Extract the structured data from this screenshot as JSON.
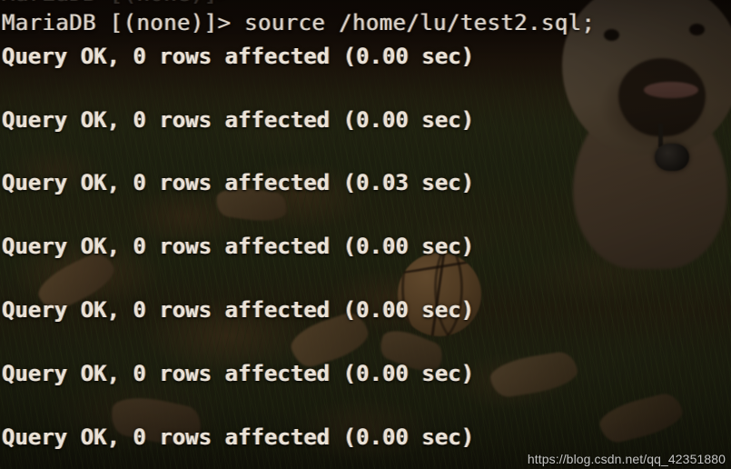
{
  "terminal": {
    "app": "MariaDB client",
    "prompt_line": "MariaDB [(none)]> source /home/lu/test2.sql;",
    "truncated_top_line": "MariaDB [(none)]>",
    "lines": [
      {
        "text": "Query OK, 0 rows affected (0.00 sec)",
        "duration": "0.00 sec"
      },
      {
        "text": "Query OK, 0 rows affected (0.00 sec)",
        "duration": "0.00 sec"
      },
      {
        "text": "Query OK, 0 rows affected (0.03 sec)",
        "duration": "0.03 sec"
      },
      {
        "text": "Query OK, 0 rows affected (0.00 sec)",
        "duration": "0.00 sec"
      },
      {
        "text": "Query OK, 0 rows affected (0.00 sec)",
        "duration": "0.00 sec"
      },
      {
        "text": "Query OK, 0 rows affected (0.00 sec)",
        "duration": "0.00 sec"
      },
      {
        "text": "Query OK, 0 rows affected (0.00 sec)",
        "duration": "0.00 sec"
      }
    ],
    "colors": {
      "text": "#eae2d6",
      "prompt_text": "#d9d2c8",
      "background_tint": "#241710"
    }
  },
  "background": {
    "description": "autumn grass and leaves photo wallpaper",
    "subjects": [
      "bulldog",
      "basketball",
      "dry-leaves",
      "grass"
    ]
  },
  "watermark": {
    "url": "https://blog.csdn.net/qq_42351880"
  }
}
